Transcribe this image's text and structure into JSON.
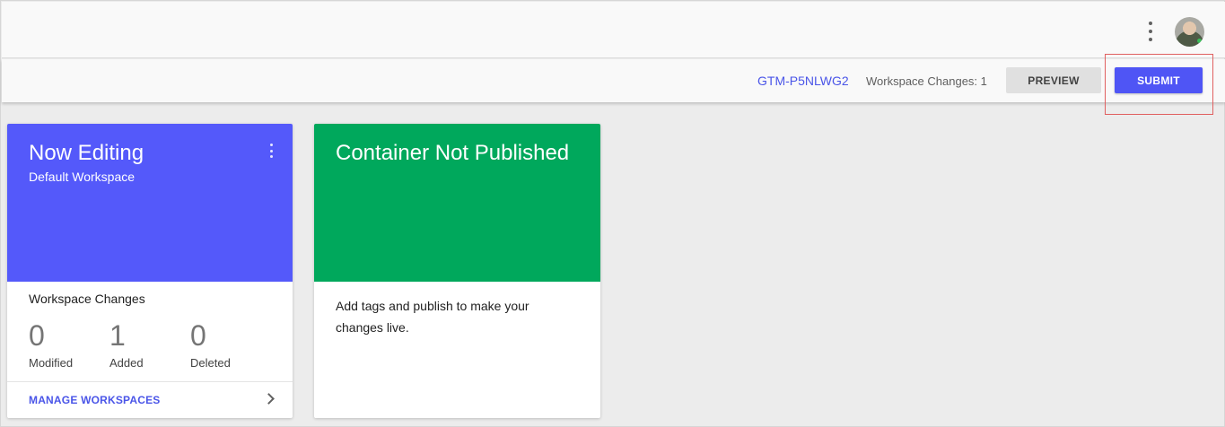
{
  "topbar": {
    "menu_icon": "more-vert-icon",
    "avatar_icon": "user-avatar"
  },
  "subbar": {
    "container_id": "GTM-P5NLWG2",
    "workspace_changes_label": "Workspace Changes: 1",
    "preview_label": "PREVIEW",
    "submit_label": "SUBMIT"
  },
  "now_editing_card": {
    "title": "Now Editing",
    "subtitle": "Default Workspace",
    "header_color": "#5459fa",
    "section_title": "Workspace Changes",
    "stats": [
      {
        "value": "0",
        "label": "Modified"
      },
      {
        "value": "1",
        "label": "Added"
      },
      {
        "value": "0",
        "label": "Deleted"
      }
    ],
    "footer_link": "MANAGE WORKSPACES"
  },
  "publish_card": {
    "title": "Container Not Published",
    "header_color": "#00a85c",
    "body": "Add tags and publish to make your changes live."
  },
  "colors": {
    "accent": "#4f55f5",
    "link": "#4a55e8",
    "highlight": "#e06060"
  }
}
